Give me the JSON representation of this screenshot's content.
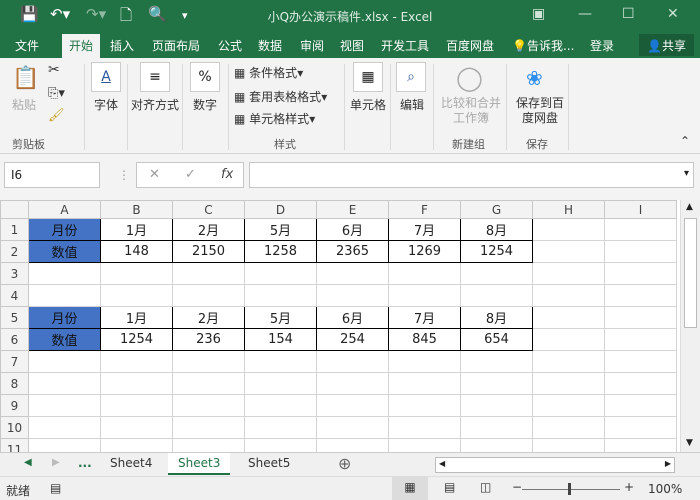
{
  "window": {
    "title": "小Q办公演示稿件.xlsx - Excel"
  },
  "ribbon_tabs": [
    "文件",
    "开始",
    "插入",
    "页面布局",
    "公式",
    "数据",
    "审阅",
    "视图",
    "开发工具",
    "百度网盘"
  ],
  "tell_me": "告诉我...",
  "login": "登录",
  "share": "共享",
  "ribbon": {
    "paste": "粘贴",
    "clipboard": "剪贴板",
    "font": "字体",
    "align": "对齐方式",
    "number": "数字",
    "cond_format": "条件格式",
    "table_format": "套用表格格式",
    "cell_style": "单元格样式",
    "styles": "样式",
    "cells": "单元格",
    "edit": "编辑",
    "compare": "比较和合并工作簿",
    "newgroup": "新建组",
    "save_baidu": "保存到百度网盘",
    "save": "保存"
  },
  "formula_bar": {
    "name_box": "I6",
    "fx": "fx",
    "value": ""
  },
  "columns": [
    "A",
    "B",
    "C",
    "D",
    "E",
    "F",
    "G",
    "H",
    "I"
  ],
  "rows": [
    [
      "月份",
      "1月",
      "2月",
      "5月",
      "6月",
      "7月",
      "8月",
      "",
      ""
    ],
    [
      "数值",
      "148",
      "2150",
      "1258",
      "2365",
      "1269",
      "1254",
      "",
      ""
    ],
    [
      "",
      "",
      "",
      "",
      "",
      "",
      "",
      "",
      ""
    ],
    [
      "",
      "",
      "",
      "",
      "",
      "",
      "",
      "",
      ""
    ],
    [
      "月份",
      "1月",
      "2月",
      "5月",
      "6月",
      "7月",
      "8月",
      "",
      ""
    ],
    [
      "数值",
      "1254",
      "236",
      "154",
      "254",
      "845",
      "654",
      "",
      ""
    ],
    [
      "",
      "",
      "",
      "",
      "",
      "",
      "",
      "",
      ""
    ],
    [
      "",
      "",
      "",
      "",
      "",
      "",
      "",
      "",
      ""
    ],
    [
      "",
      "",
      "",
      "",
      "",
      "",
      "",
      "",
      ""
    ],
    [
      "",
      "",
      "",
      "",
      "",
      "",
      "",
      "",
      ""
    ],
    [
      "",
      "",
      "",
      "",
      "",
      "",
      "",
      "",
      ""
    ]
  ],
  "sheets": {
    "ellipsis": "...",
    "tabs": [
      "Sheet4",
      "Sheet3",
      "Sheet5"
    ],
    "active": "Sheet3"
  },
  "status": {
    "ready": "就绪",
    "zoom": "100%"
  }
}
